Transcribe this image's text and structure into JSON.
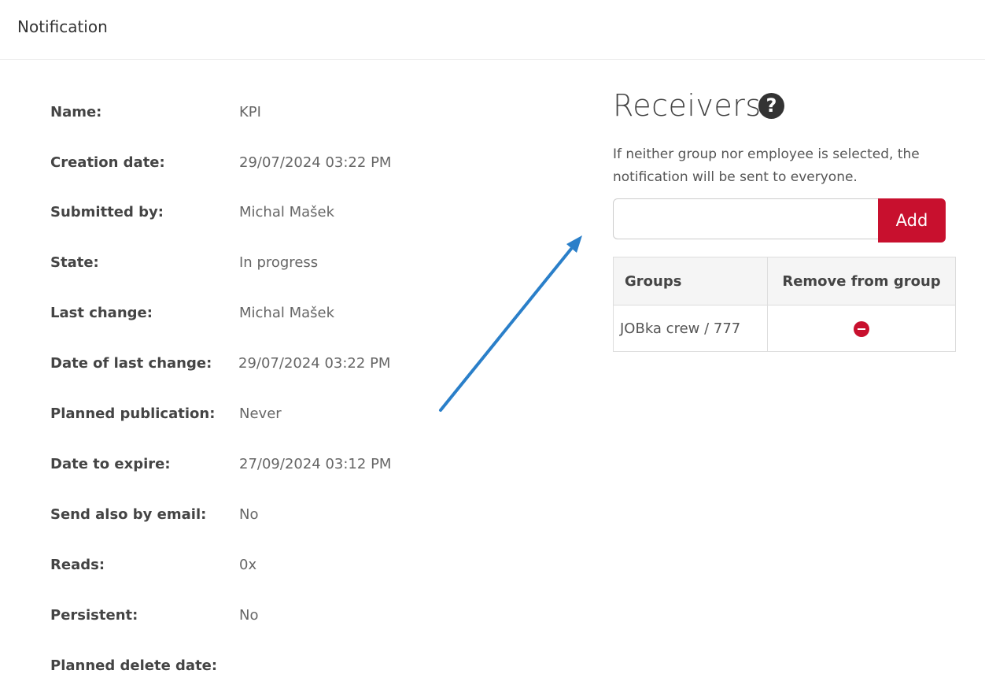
{
  "header": {
    "title": "Notification"
  },
  "details": [
    {
      "label": "Name:",
      "value": "KPI"
    },
    {
      "label": "Creation date:",
      "value": "29/07/2024 03:22 PM"
    },
    {
      "label": "Submitted by:",
      "value": "Michal Mašek"
    },
    {
      "label": "State:",
      "value": "In progress"
    },
    {
      "label": "Last change:",
      "value": "Michal Mašek"
    },
    {
      "label": "Date of last change:",
      "value": "29/07/2024 03:22 PM"
    },
    {
      "label": "Planned publication:",
      "value": "Never"
    },
    {
      "label": "Date to expire:",
      "value": "27/09/2024 03:12 PM"
    },
    {
      "label": "Send also by email:",
      "value": "No"
    },
    {
      "label": "Reads:",
      "value": "0x"
    },
    {
      "label": "Persistent:",
      "value": "No"
    },
    {
      "label": "Planned delete date:",
      "value": ""
    }
  ],
  "receivers": {
    "title": "Receivers",
    "help_icon": "question-circle-icon",
    "hint": "If neither group nor employee is selected, the notification will be sent to everyone.",
    "input": {
      "value": "",
      "placeholder": ""
    },
    "add_label": "Add",
    "table": {
      "columns": [
        "Groups",
        "Remove from group"
      ],
      "rows": [
        {
          "group": "JOBka crew / 777",
          "remove_icon": "minus-circle-icon"
        }
      ]
    }
  },
  "colors": {
    "accent": "#c8102e",
    "arrow": "#2a7fc9"
  }
}
